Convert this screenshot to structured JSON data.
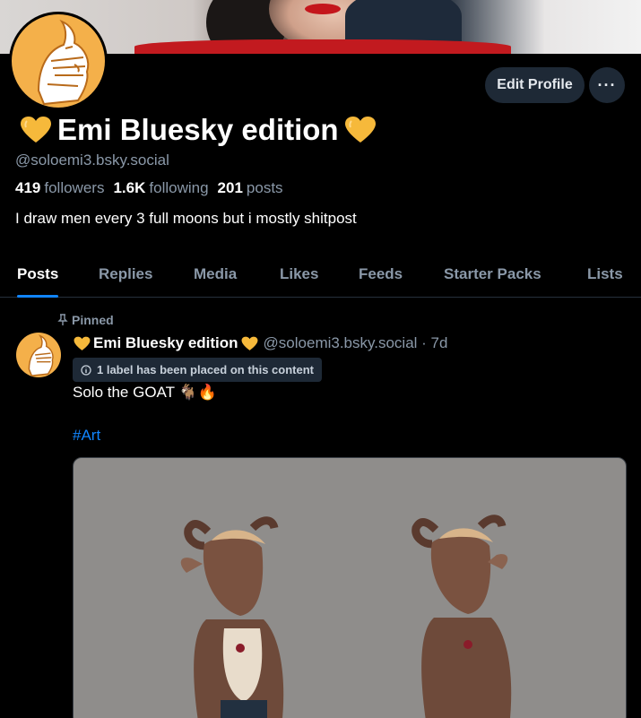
{
  "profile": {
    "display_name": "Emi Bluesky edition",
    "handle": "@soloemi3.bsky.social",
    "followers_count": "419",
    "followers_label": "followers",
    "following_count": "1.6K",
    "following_label": "following",
    "posts_count": "201",
    "posts_label": "posts",
    "bio": "I draw men every 3 full moons but i mostly shitpost"
  },
  "actions": {
    "edit_label": "Edit Profile",
    "more_label": "···"
  },
  "tabs": [
    {
      "label": "Posts",
      "active": true
    },
    {
      "label": "Replies"
    },
    {
      "label": "Media"
    },
    {
      "label": "Likes"
    },
    {
      "label": "Feeds"
    },
    {
      "label": "Starter Packs"
    },
    {
      "label": "Lists"
    }
  ],
  "post": {
    "pinned_label": "Pinned",
    "author_name": "Emi Bluesky edition",
    "author_meta": "@soloemi3.bsky.social · 7d",
    "label_notice": "1 label has been placed on this content",
    "text": "Solo the GOAT 🐐🔥",
    "hashtag": "#Art"
  },
  "colors": {
    "accent": "#1185fe",
    "heart": "#f6b93b",
    "muted": "#8a98a8",
    "button_bg": "#1e2936"
  },
  "icons": {
    "pin": "pin-icon",
    "info": "info-icon",
    "heart": "yellow-heart-icon"
  }
}
